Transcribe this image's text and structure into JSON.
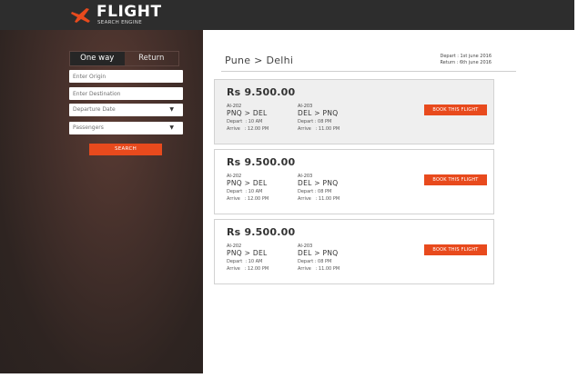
{
  "header": {
    "logo_title": "FLIGHT",
    "logo_subtitle": "SEARCH ENGINE",
    "logo_icon": "airplane-icon"
  },
  "sidebar": {
    "tabs": [
      {
        "label": "One way",
        "active": true
      },
      {
        "label": "Return",
        "active": false
      }
    ],
    "origin_placeholder": "Enter Origin",
    "destination_placeholder": "Enter Destination",
    "departure_label": "Departure Date",
    "passengers_label": "Passengers",
    "search_label": "SEARCH"
  },
  "results": {
    "route": "Pune  >  Delhi",
    "depart_date": "Depart : 1st june 2016",
    "return_date": "Return : 6th june 2016",
    "cards": [
      {
        "price": "Rs 9.500.00",
        "out_flight": "AI-202",
        "out_route": "PNQ > DEL",
        "out_depart": "Depart  : 10 AM",
        "out_arrive": "Arrive   : 12.00 PM",
        "ret_flight": "AI-203",
        "ret_route": "DEL > PNQ",
        "ret_depart": "Depart : 08 PM",
        "ret_arrive": "Arrive   : 11.00 PM",
        "book_label": "BOOK THIS FLIGHT"
      },
      {
        "price": "Rs 9.500.00",
        "out_flight": "AI-202",
        "out_route": "PNQ > DEL",
        "out_depart": "Depart  : 10 AM",
        "out_arrive": "Arrive   : 12.00 PM",
        "ret_flight": "AI-203",
        "ret_route": "DEL > PNQ",
        "ret_depart": "Depart : 08 PM",
        "ret_arrive": "Arrive   : 11.00 PM",
        "book_label": "BOOK THIS FLIGHT"
      },
      {
        "price": "Rs 9.500.00",
        "out_flight": "AI-202",
        "out_route": "PNQ > DEL",
        "out_depart": "Depart  : 10 AM",
        "out_arrive": "Arrive   : 12.00 PM",
        "ret_flight": "AI-203",
        "ret_route": "DEL > PNQ",
        "ret_depart": "Depart : 08 PM",
        "ret_arrive": "Arrive   : 11.00 PM",
        "book_label": "BOOK THIS FLIGHT"
      }
    ]
  },
  "colors": {
    "accent": "#e84a1d",
    "header_bg": "#2d2d2d",
    "sidebar_bg": "#45302b",
    "highlight_card_bg": "#efefef"
  }
}
